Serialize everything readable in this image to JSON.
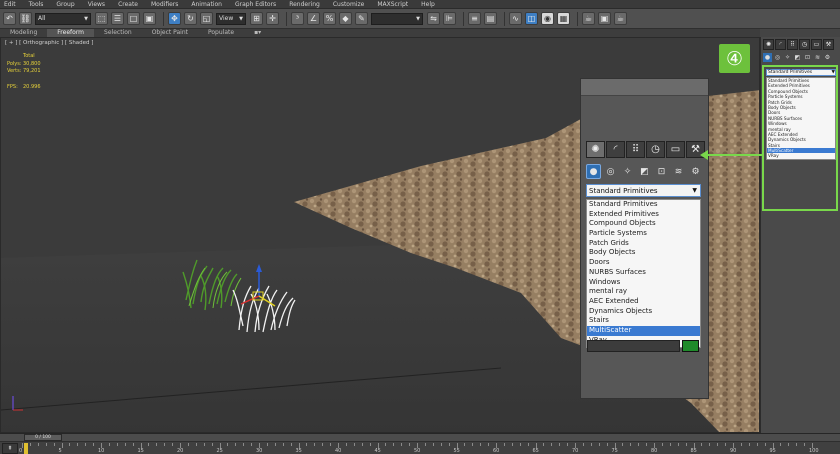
{
  "menu": [
    "Edit",
    "Tools",
    "Group",
    "Views",
    "Create",
    "Modifiers",
    "Animation",
    "Graph Editors",
    "Rendering",
    "Customize",
    "MAXScript",
    "Help"
  ],
  "toolbar": {
    "selection_filter": "All",
    "coord_system": "View"
  },
  "ribbon": {
    "tabs": [
      "Modeling",
      "Freeform",
      "Selection",
      "Object Paint",
      "Populate"
    ],
    "active": "Freeform"
  },
  "viewport": {
    "label": "[ + ] [ Orthographic ] [ Shaded ]",
    "stats_header": "Total",
    "stats": [
      {
        "key": "Polys:",
        "value": "30,800"
      },
      {
        "key": "Verts:",
        "value": "79,201"
      }
    ],
    "fps_key": "FPS:",
    "fps_value": "20.996"
  },
  "command_panel": {
    "dropdown_value": "Standard Primitives",
    "items": [
      "Standard Primitives",
      "Extended Primitives",
      "Compound Objects",
      "Particle Systems",
      "Patch Grids",
      "Body Objects",
      "Doors",
      "NURBS Surfaces",
      "Windows",
      "mental ray",
      "AEC Extended",
      "Dynamics Objects",
      "Stairs",
      "MultiScatter",
      "VRay"
    ],
    "selected": "MultiScatter"
  },
  "right_panel": {
    "dropdown_value": "Standard Primitives",
    "items": [
      "Standard Primitives",
      "Extended Primitives",
      "Compound Objects",
      "Particle Systems",
      "Patch Grids",
      "Body Objects",
      "Doors",
      "NURBS Surfaces",
      "Windows",
      "mental ray",
      "AEC Extended",
      "Dynamics Objects",
      "Stairs",
      "MultiScatter",
      "VRay"
    ],
    "selected": "MultiScatter"
  },
  "step_badge": "④",
  "timeline": {
    "frame_counter": "0 / 100",
    "ticks": [
      "0",
      "5",
      "10",
      "15",
      "20",
      "25",
      "30",
      "35",
      "40",
      "45",
      "50",
      "55",
      "60",
      "65",
      "70",
      "75",
      "80",
      "85",
      "90",
      "95",
      "100"
    ]
  },
  "colors": {
    "accent_green": "#6dc13c",
    "selection_blue": "#3a7ad1",
    "stats_yellow": "#e7d23a"
  },
  "icons": {
    "create_tab": "sun-icon",
    "modify_tab": "arc-icon",
    "hierarchy_tab": "hierarchy-icon",
    "motion_tab": "clock-icon",
    "display_tab": "monitor-icon",
    "utilities_tab": "hammer-icon"
  }
}
